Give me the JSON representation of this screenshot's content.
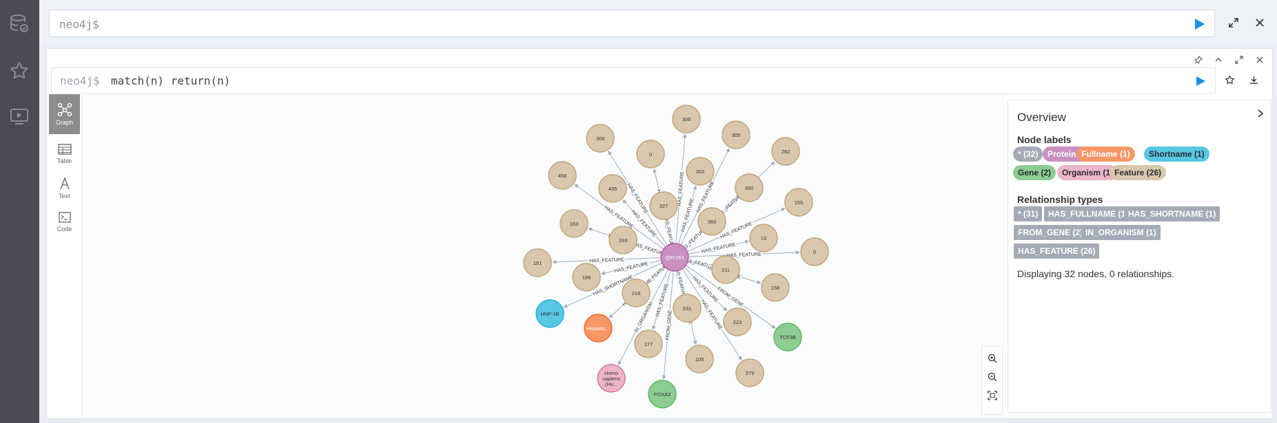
{
  "topbar": {
    "prompt": "neo4j$"
  },
  "frame": {
    "prompt": "neo4j$",
    "query": "match(n) return(n)"
  },
  "views": [
    {
      "label": "Graph",
      "icon": "graph-icon",
      "active": true
    },
    {
      "label": "Table",
      "icon": "table-icon",
      "active": false
    },
    {
      "label": "Text",
      "icon": "text-icon",
      "active": false
    },
    {
      "label": "Code",
      "icon": "code-icon",
      "active": false
    }
  ],
  "overview": {
    "title": "Overview",
    "node_labels_heading": "Node labels",
    "node_labels": [
      {
        "label": "* (32)",
        "color": "#a5abb6",
        "text": "#ffffff"
      },
      {
        "label": "Protein (1)",
        "color": "#c990c0",
        "text": "#ffffff"
      },
      {
        "label": "Fullname (1)",
        "color": "#f79767",
        "text": "#ffffff"
      },
      {
        "label": "Shortname (1)",
        "color": "#57c7e3",
        "text": "#2a2c34"
      },
      {
        "label": "Gene (2)",
        "color": "#8dcc93",
        "text": "#2a2c34"
      },
      {
        "label": "Organism (1)",
        "color": "#ecb5c9",
        "text": "#2a2c34"
      },
      {
        "label": "Feature (26)",
        "color": "#d9c8ae",
        "text": "#2a2c34"
      }
    ],
    "rel_types_heading": "Relationship types",
    "rel_types": [
      "* (31)",
      "HAS_FULLNAME (1)",
      "HAS_SHORTNAME (1)",
      "FROM_GENE (2)",
      "IN_ORGANISM (1)",
      "HAS_FEATURE (26)"
    ],
    "summary": "Displaying 32 nodes, 0 relationships."
  },
  "graph": {
    "center": {
      "label": "Q9Y261",
      "color": "#c990c0"
    },
    "nodes": [
      {
        "label": "308",
        "type": "feature",
        "rel": "HAS_FEATURE"
      },
      {
        "label": "0",
        "type": "feature",
        "rel": "HAS_FEATURE"
      },
      {
        "label": "306",
        "type": "feature",
        "rel": "HAS_FEATURE"
      },
      {
        "label": "305",
        "type": "feature",
        "rel": "HAS_FEATURE"
      },
      {
        "label": "282",
        "type": "feature",
        "rel": "HAS_FEATURE"
      },
      {
        "label": "456",
        "type": "feature",
        "rel": "HAS_FEATURE"
      },
      {
        "label": "435",
        "type": "feature",
        "rel": "HAS_FEATURE"
      },
      {
        "label": "327",
        "type": "feature",
        "rel": "HAS_FEATURE"
      },
      {
        "label": "302",
        "type": "feature",
        "rel": "HAS_FEATURE"
      },
      {
        "label": "300",
        "type": "feature",
        "rel": "HAS_FEATURE"
      },
      {
        "label": "155",
        "type": "feature",
        "rel": "HAS_FEATURE"
      },
      {
        "label": "163",
        "type": "feature",
        "rel": "HAS_FEATURE"
      },
      {
        "label": "360",
        "type": "feature",
        "rel": "HAS_FEATURE"
      },
      {
        "label": "193",
        "type": "feature",
        "rel": "HAS_FEATURE"
      },
      {
        "label": "13",
        "type": "feature",
        "rel": "HAS_FEATURE"
      },
      {
        "label": "0",
        "type": "feature",
        "rel": "HAS_FEATURE"
      },
      {
        "label": "181",
        "type": "feature",
        "rel": "HAS_FEATURE"
      },
      {
        "label": "211",
        "type": "feature",
        "rel": "HAS_FEATURE"
      },
      {
        "label": "199",
        "type": "feature",
        "rel": "HAS_FEATURE"
      },
      {
        "label": "158",
        "type": "feature",
        "rel": "HAS_FEATURE"
      },
      {
        "label": "216",
        "type": "feature",
        "rel": "HAS_FEATURE"
      },
      {
        "label": "231",
        "type": "feature",
        "rel": "HAS_FEATURE"
      },
      {
        "label": "HNF-3B",
        "type": "shortname",
        "rel": "HAS_SHORTNAME"
      },
      {
        "label": "223",
        "type": "feature",
        "rel": "HAS_FEATURE"
      },
      {
        "label": "TCF3B",
        "type": "gene",
        "rel": "FROM_GENE"
      },
      {
        "label": "Hepatoc...",
        "type": "fullname",
        "rel": "HAS_FULLNAME"
      },
      {
        "label": "177",
        "type": "feature",
        "rel": "HAS_FEATURE"
      },
      {
        "label": "105",
        "type": "feature",
        "rel": "HAS_FEATURE"
      },
      {
        "label": "279",
        "type": "feature",
        "rel": "HAS_FEATURE"
      },
      {
        "label": "Homo sapiens (Hu...",
        "type": "organism",
        "rel": "IN_ORGANISM"
      },
      {
        "label": "FOXA2",
        "type": "gene",
        "rel": "FROM_GENE"
      }
    ],
    "type_colors": {
      "feature": {
        "fill": "#d9c8ae",
        "stroke": "#c0a378"
      },
      "shortname": {
        "fill": "#57c7e3",
        "stroke": "#23b3d7"
      },
      "gene": {
        "fill": "#8dcc93",
        "stroke": "#5db665"
      },
      "fullname": {
        "fill": "#f79767",
        "stroke": "#f36924"
      },
      "organism": {
        "fill": "#ecb5c9",
        "stroke": "#da7298"
      }
    }
  }
}
